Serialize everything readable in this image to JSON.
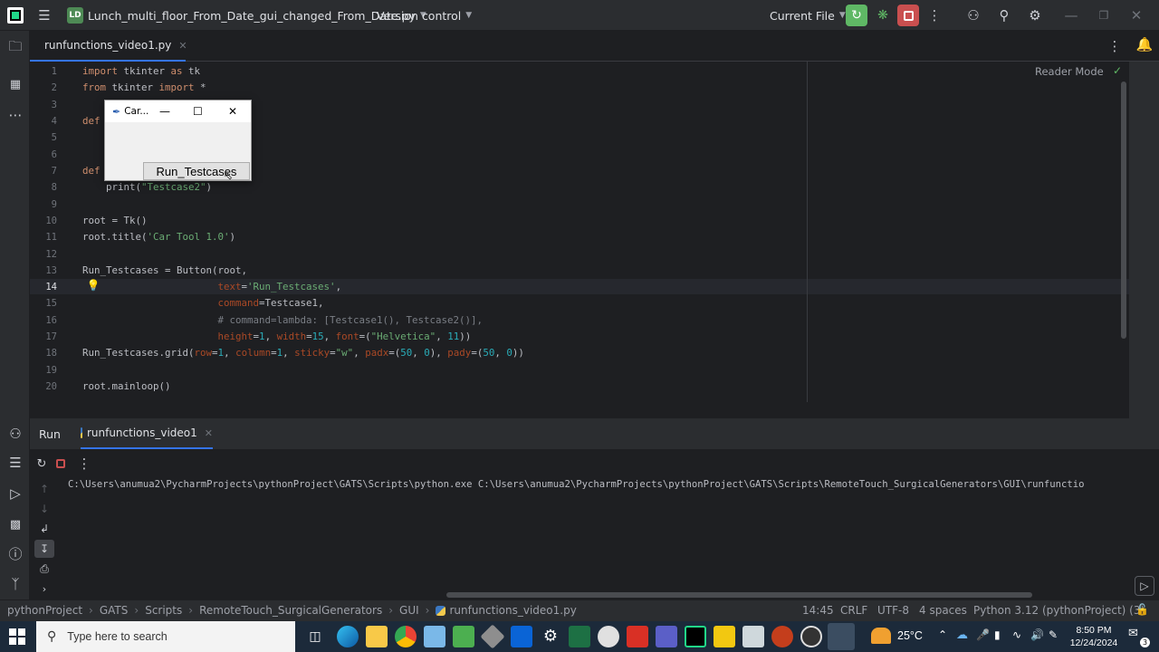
{
  "titlebar": {
    "project_badge": "LD",
    "project_name": "Lunch_multi_floor_From_Date_gui_changed_From_Date.py",
    "vcs_label": "Version control",
    "run_config": "Current File"
  },
  "tab": {
    "filename": "runfunctions_video1.py"
  },
  "editor": {
    "reader_mode": "Reader Mode",
    "line_numbers": [
      "1",
      "2",
      "3",
      "4",
      "5",
      "6",
      "7",
      "8",
      "9",
      "10",
      "11",
      "12",
      "13",
      "14",
      "15",
      "16",
      "17",
      "18",
      "19",
      "20"
    ],
    "current_line": "14",
    "tk_window": {
      "title": "Car...",
      "button_label": "Run_Testcases"
    }
  },
  "run_panel": {
    "tab_label": "Run",
    "config_tab": "runfunctions_video1",
    "console_line": "C:\\Users\\anumua2\\PycharmProjects\\pythonProject\\GATS\\Scripts\\python.exe C:\\Users\\anumua2\\PycharmProjects\\pythonProject\\GATS\\Scripts\\RemoteTouch_SurgicalGenerators\\GUI\\runfunctio"
  },
  "statusbar": {
    "breadcrumbs": [
      "pythonProject",
      "GATS",
      "Scripts",
      "RemoteTouch_SurgicalGenerators",
      "GUI",
      "runfunctions_video1.py"
    ],
    "position": "14:45",
    "line_sep": "CRLF",
    "encoding": "UTF-8",
    "indent": "4 spaces",
    "interpreter": "Python 3.12 (pythonProject) (3)"
  },
  "taskbar": {
    "search_placeholder": "Type here to search",
    "temperature": "25°C",
    "time": "8:50 PM",
    "date": "12/24/2024",
    "notif_count": "3"
  }
}
